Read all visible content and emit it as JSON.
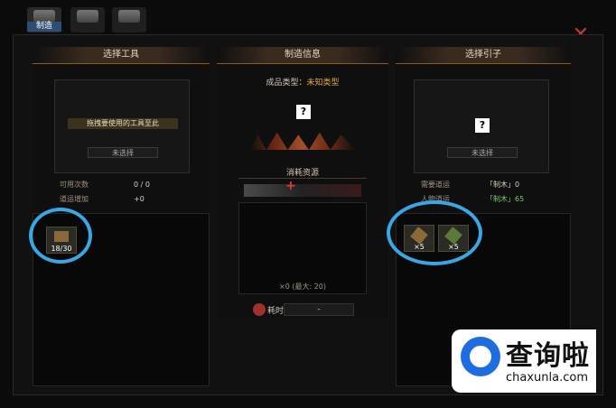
{
  "tabs": [
    {
      "label": "制造",
      "active": true,
      "icon": "craft-tab-icon"
    },
    {
      "label": "",
      "active": false,
      "icon": "character-tab-icon"
    },
    {
      "label": "",
      "active": false,
      "icon": "machine-tab-icon"
    }
  ],
  "close_icon": "✕",
  "left": {
    "header": "选择工具",
    "drop_hint": "拖拽要使用的工具至此",
    "unselected": "未选择",
    "stats": [
      {
        "label": "可用次数",
        "value": "0 / 0"
      },
      {
        "label": "道运增加",
        "value": "+0"
      }
    ],
    "items": [
      {
        "count": "18/30",
        "icon": "toolbox-icon"
      }
    ]
  },
  "center": {
    "header": "制造信息",
    "product_type_label": "成品类型：",
    "product_type_value": "未知类型",
    "qmark": "?",
    "consume_header": "消耗资源",
    "plus": "+",
    "quantity": "×0 (最大: 20)",
    "time_label": "耗时",
    "time_value": "-"
  },
  "right": {
    "header": "选择引子",
    "qmark": "?",
    "unselected": "未选择",
    "stats": [
      {
        "label": "需要道运",
        "value": "「制木」0"
      },
      {
        "label": "人物道运",
        "value": "「制木」65"
      }
    ],
    "items": [
      {
        "count": "×5",
        "icon": "scroll-icon"
      },
      {
        "count": "×5",
        "icon": "scroll-green-icon"
      }
    ]
  },
  "watermark": {
    "cn": "查询啦",
    "en": "chaxunla.com"
  },
  "colors": {
    "accent_red": "#c23b2b",
    "highlight_circle": "#3ba6e4",
    "product_type": "#e0a83c",
    "stat_green": "#7bc86a"
  }
}
